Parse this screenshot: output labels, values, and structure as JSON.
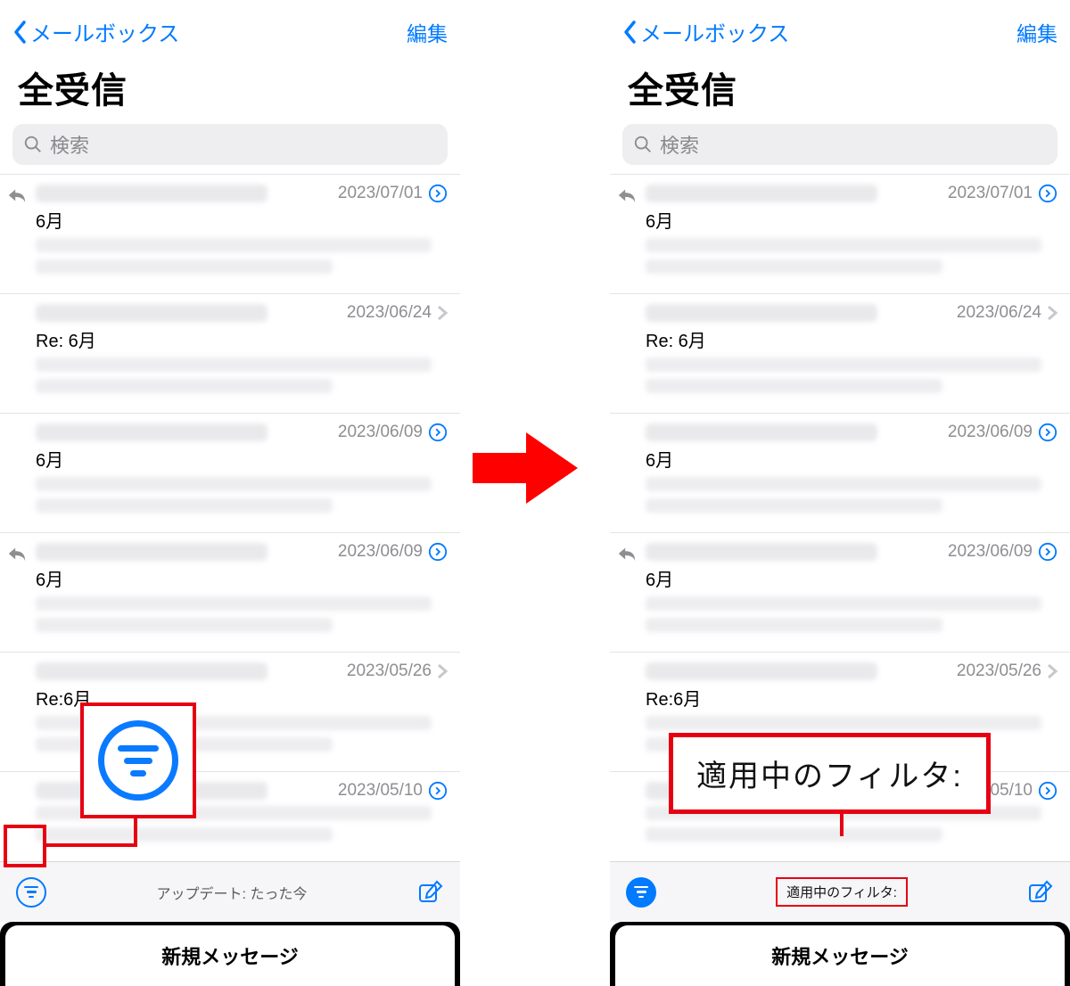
{
  "nav": {
    "back_label": "メールボックス",
    "edit_label": "編集"
  },
  "title": "全受信",
  "search": {
    "placeholder": "検索"
  },
  "messages": [
    {
      "date": "2023/07/01",
      "subject": "6月",
      "replied": true,
      "disclosure": "info"
    },
    {
      "date": "2023/06/24",
      "subject": "Re: 6月",
      "replied": false,
      "disclosure": "chev"
    },
    {
      "date": "2023/06/09",
      "subject": "6月",
      "replied": false,
      "disclosure": "info"
    },
    {
      "date": "2023/06/09",
      "subject": "6月",
      "replied": true,
      "disclosure": "info"
    },
    {
      "date": "2023/05/26",
      "subject": "Re:6月",
      "replied": false,
      "disclosure": "chev"
    },
    {
      "date": "2023/05/10",
      "subject": "",
      "replied": false,
      "disclosure": "info"
    }
  ],
  "toolbar_left": {
    "center": "アップデート: たった今"
  },
  "toolbar_right": {
    "center": "適用中のフィルタ:"
  },
  "callout_right_label": "適用中のフィルタ:",
  "sheet_label": "新規メッセージ",
  "colors": {
    "accent": "#007aff",
    "highlight": "#e60012"
  }
}
